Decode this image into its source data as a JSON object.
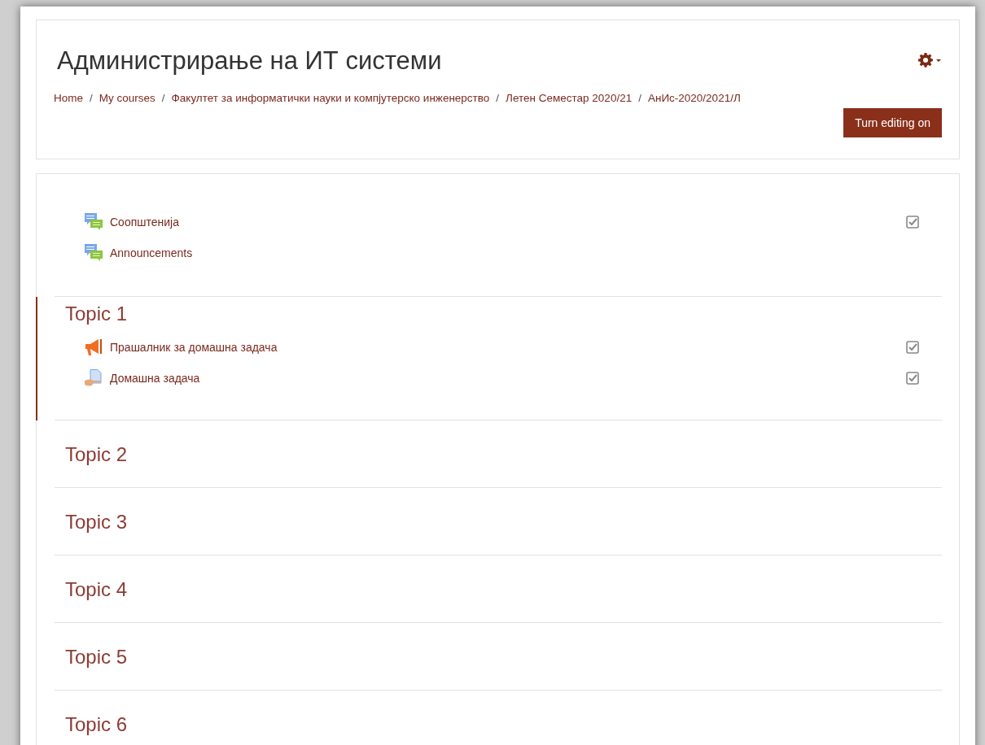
{
  "header": {
    "title": "Администрирање на ИТ системи",
    "breadcrumb": [
      {
        "label": "Home"
      },
      {
        "label": "My courses"
      },
      {
        "label": "Факултет за информатички науки и компјутерско инженерство"
      },
      {
        "label": "Летен Семестар 2020/21"
      },
      {
        "label": "АнИс-2020/2021/Л"
      }
    ],
    "separator": "/",
    "edit_button": "Turn editing on"
  },
  "sections": [
    {
      "highlighted": false,
      "activities": [
        {
          "kind": "forum",
          "name": "Соопштенија",
          "completion": true
        },
        {
          "kind": "forum",
          "name": "Announcements",
          "completion": false
        }
      ]
    },
    {
      "title": "Topic 1",
      "highlighted": true,
      "activities": [
        {
          "kind": "feedback",
          "name": "Прашалник за домашна задача",
          "completion": true
        },
        {
          "kind": "assignment",
          "name": "Домашна задача",
          "completion": true
        }
      ]
    },
    {
      "title": "Topic 2",
      "highlighted": false
    },
    {
      "title": "Topic 3",
      "highlighted": false
    },
    {
      "title": "Topic 4",
      "highlighted": false
    },
    {
      "title": "Topic 5",
      "highlighted": false
    },
    {
      "title": "Topic 6",
      "highlighted": false
    }
  ]
}
